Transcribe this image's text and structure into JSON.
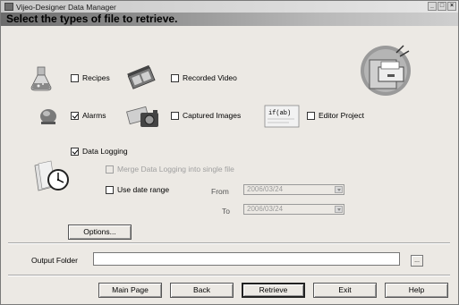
{
  "window": {
    "title": "Vijeo-Designer Data Manager",
    "buttons": {
      "minimize": "_",
      "maximize": "□",
      "close": "×"
    }
  },
  "header": {
    "text": "Select the types of file to retrieve."
  },
  "options": {
    "recipes": {
      "label": "Recipes",
      "checked": false
    },
    "recorded_video": {
      "label": "Recorded Video",
      "checked": false
    },
    "alarms": {
      "label": "Alarms",
      "checked": true
    },
    "captured_images": {
      "label": "Captured Images",
      "checked": false
    },
    "editor_project": {
      "label": "Editor Project",
      "checked": false,
      "icon_text": "if(ab)"
    },
    "data_logging": {
      "label": "Data Logging",
      "checked": true
    },
    "merge_data_logging": {
      "label": "Merge Data Logging into single file",
      "checked": false,
      "disabled": true
    },
    "use_date_range": {
      "label": "Use date range",
      "checked": false
    }
  },
  "date_range": {
    "from_label": "From",
    "from_value": "2006/03/24",
    "to_label": "To",
    "to_value": "2006/03/24"
  },
  "options_button": "Options...",
  "output": {
    "label": "Output Folder",
    "value": "",
    "browse_label": "..."
  },
  "footer": {
    "main_page": "Main Page",
    "back": "Back",
    "retrieve": "Retrieve",
    "exit": "Exit",
    "help": "Help"
  },
  "icons": {
    "flask": "flask-icon",
    "video": "video-icon",
    "alarm": "alarm-icon",
    "camera": "camera-icon",
    "code": "code-icon",
    "clock": "clock-icon",
    "cabinet": "file-cabinet-icon"
  }
}
